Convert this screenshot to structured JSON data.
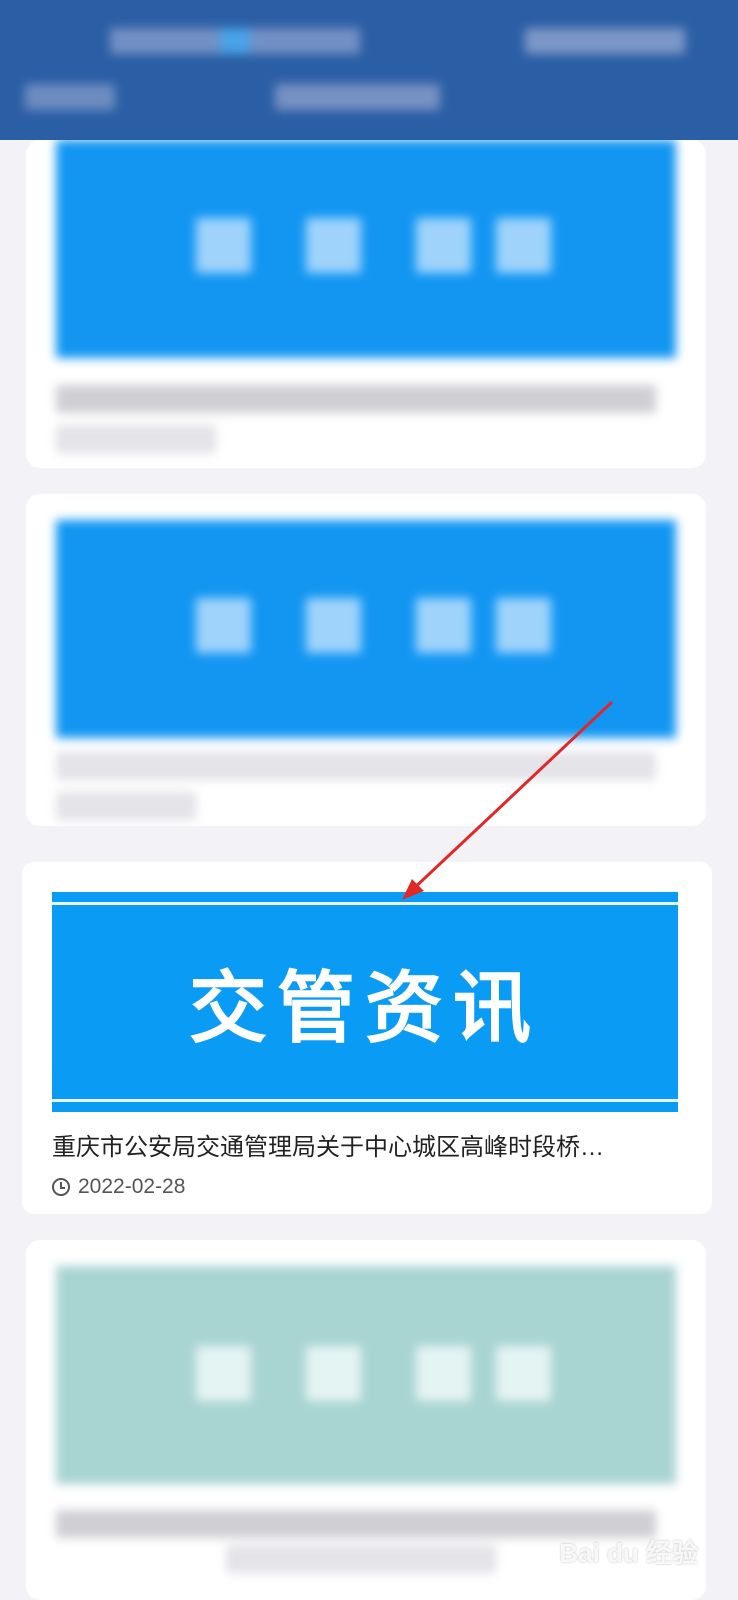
{
  "focused_card": {
    "banner_text": "交管资讯",
    "title": "重庆市公安局交通管理局关于中心城区高峰时段桥…",
    "date": "2022-02-28"
  },
  "icons": {
    "clock": "clock-icon"
  },
  "colors": {
    "header": "#2b5fa5",
    "banner": "#0a9cf5",
    "annotation_arrow": "#e02828",
    "page_background": "#f3f2f7"
  },
  "watermark": "Bai du 经验"
}
